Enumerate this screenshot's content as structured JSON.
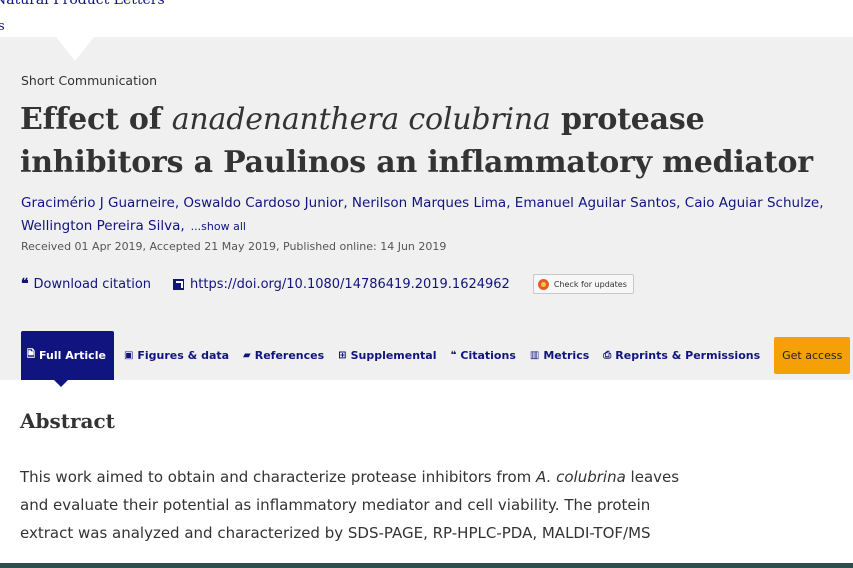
{
  "journal": {
    "name": "Natural Product Letters",
    "sub": "s"
  },
  "article": {
    "type": "Short Communication",
    "title_pre": "Effect of ",
    "title_italic": "anadenanthera colubrina",
    "title_post": " protease inhibitors a Paulinos an inflammatory mediator",
    "authors": [
      "Gracimério J Guarneire,",
      "Oswaldo Cardoso Junior,",
      "Nerilson Marques Lima,",
      "Emanuel Aguilar Santos,",
      "Caio Aguiar Schulze,",
      "Wellington Pereira Silva,"
    ],
    "show_all": "...show all",
    "dates": "Received 01 Apr 2019, Accepted 21 May 2019, Published online: 14 Jun 2019"
  },
  "links": {
    "download_citation": "Download citation",
    "doi": "https://doi.org/10.1080/14786419.2019.1624962",
    "check_updates": "Check for updates"
  },
  "tabs": [
    {
      "label": "Full Article",
      "icon": "file-icon"
    },
    {
      "label": "Figures & data",
      "icon": "image-icon"
    },
    {
      "label": "References",
      "icon": "book-icon"
    },
    {
      "label": "Supplemental",
      "icon": "plus-icon"
    },
    {
      "label": "Citations",
      "icon": "quote-icon"
    },
    {
      "label": "Metrics",
      "icon": "bar-chart-icon"
    },
    {
      "label": "Reprints & Permissions",
      "icon": "print-icon"
    }
  ],
  "get_access": "Get access",
  "abstract": {
    "heading": "Abstract",
    "l1_pre": "This work aimed to obtain and characterize protease inhibitors from ",
    "l1_italic": "A. colubrina",
    "l1_post": " leaves",
    "l2": "and evaluate their potential as inflammatory mediator and cell viability. The protein",
    "l3": "extract was analyzed and characterized by SDS-PAGE, RP-HPLC-PDA, MALDI-TOF/MS"
  },
  "colors": {
    "link": "#10147e",
    "active_tab": "#10147e",
    "access_button": "#f5a007",
    "band": "#f0f0f0"
  }
}
